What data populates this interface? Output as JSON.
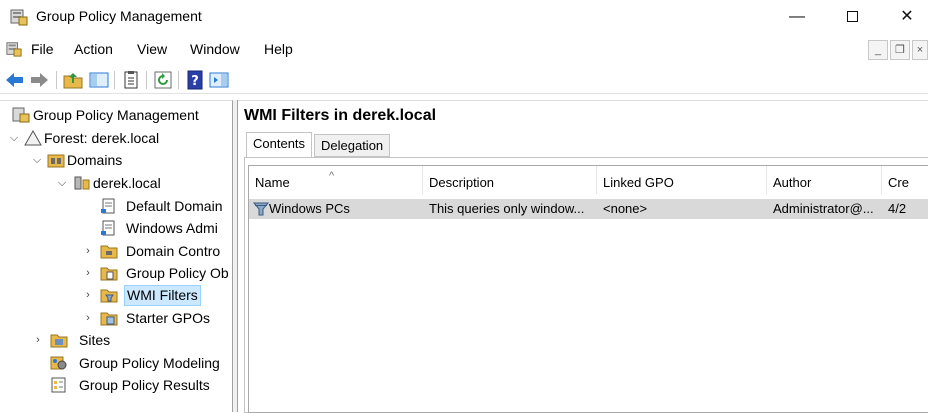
{
  "window": {
    "title": "Group Policy Management",
    "minimize": "—",
    "close": "✕"
  },
  "menu": {
    "items": [
      "File",
      "Action",
      "View",
      "Window",
      "Help"
    ],
    "mdi_minimize": "_",
    "mdi_restore": "❐",
    "mdi_close": "×"
  },
  "toolbar": {
    "buttons": [
      "back-icon",
      "forward-icon",
      "folder-up-icon",
      "show-tree-icon",
      "properties-icon",
      "refresh-icon",
      "help-icon",
      "show-action-pane-icon"
    ]
  },
  "tree": {
    "root": "Group Policy Management",
    "forest": "Forest: derek.local",
    "domains": "Domains",
    "domain": "derek.local",
    "default_domain": "Default Domain",
    "windows_admin": "Windows Admi",
    "domain_controllers": "Domain Contro",
    "gpo": "Group Policy Ob",
    "wmi_filters": "WMI Filters",
    "starter_gpos": "Starter GPOs",
    "sites": "Sites",
    "modeling": "Group Policy Modeling",
    "results": "Group Policy Results"
  },
  "details": {
    "title": "WMI Filters in derek.local",
    "tabs": [
      "Contents",
      "Delegation"
    ],
    "columns": [
      "Name",
      "Description",
      "Linked GPO",
      "Author",
      "Cre"
    ],
    "rows": [
      {
        "name": "Windows PCs",
        "description": "This queries only window...",
        "linked_gpo": "<none>",
        "author": "Administrator@...",
        "created": "4/2"
      }
    ]
  },
  "colors": {
    "selection": "#cce8ff",
    "row_highlight": "#d9d9d9",
    "accent_blue": "#1a6fd6"
  }
}
